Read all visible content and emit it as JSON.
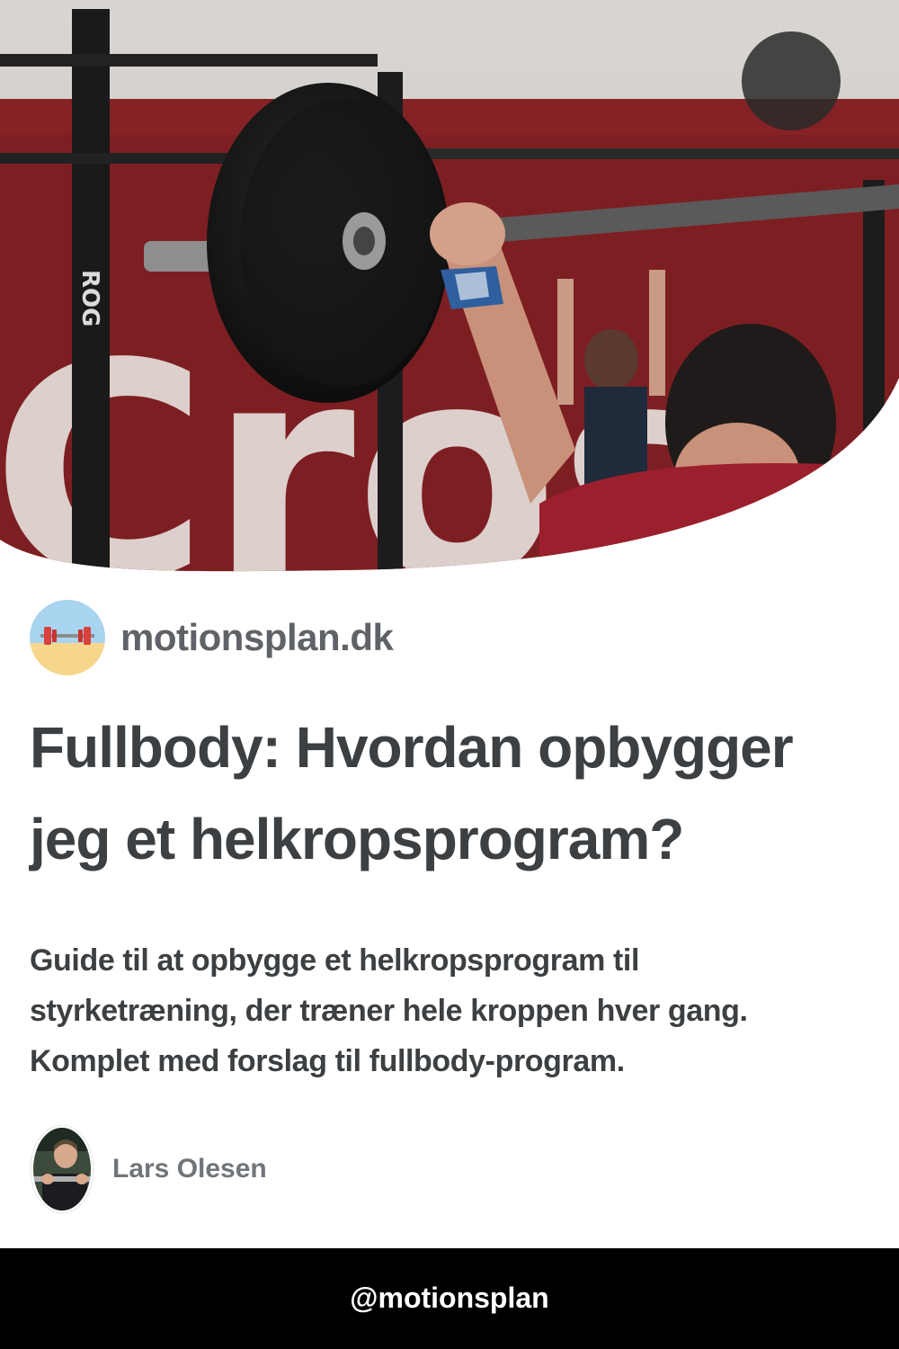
{
  "hero": {
    "image": "gym-weightlifting-photo",
    "wall_lettering": "Cros",
    "rig_lettering": "ROG"
  },
  "site": {
    "logo_icon": "barbell-beach-icon",
    "name": "motionsplan.dk"
  },
  "article": {
    "title": "Fullbody: Hvordan opbygger jeg et helkropsprogram?",
    "description": "Guide til at opbygge et helkropsprogram til styrketræning, der træner hele kroppen hver gang. Komplet med forslag til fullbody-program."
  },
  "author": {
    "avatar_icon": "author-photo",
    "name": "Lars Olesen"
  },
  "footer": {
    "handle": "@motionsplan"
  },
  "colors": {
    "text_dark": "#3c4043",
    "text_muted": "#5f6368",
    "author_text": "#70757a",
    "footer_bg": "#000000",
    "hero_wall_red": "#7d1f22"
  }
}
